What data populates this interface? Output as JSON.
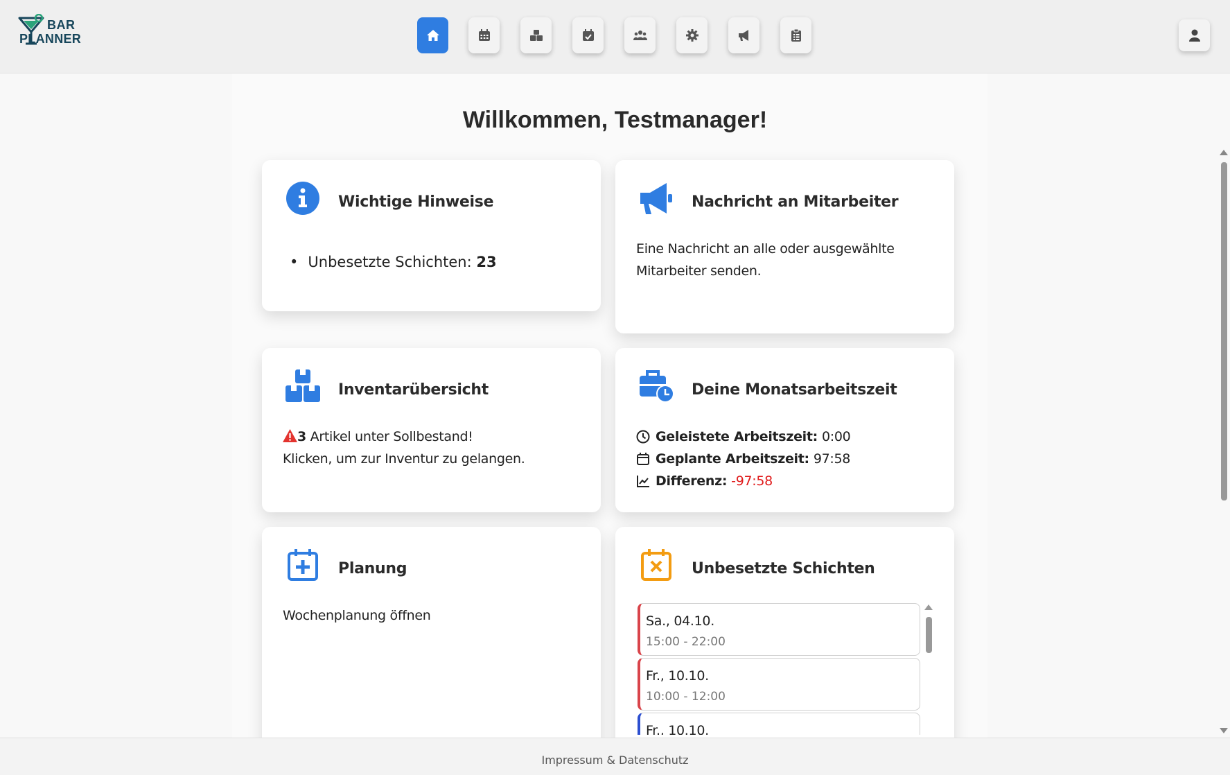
{
  "app": {
    "logo_line1": "BAR",
    "logo_line2": "PLANNER"
  },
  "nav": {
    "items": [
      {
        "icon": "home-icon",
        "active": true
      },
      {
        "icon": "calendar-grid-icon",
        "active": false
      },
      {
        "icon": "boxes-icon",
        "active": false
      },
      {
        "icon": "calendar-check-icon",
        "active": false
      },
      {
        "icon": "users-icon",
        "active": false
      },
      {
        "icon": "gear-icon",
        "active": false
      },
      {
        "icon": "megaphone-icon",
        "active": false
      },
      {
        "icon": "clipboard-list-icon",
        "active": false
      }
    ],
    "user_icon": "user-icon",
    "accent": "#2f7de1"
  },
  "page": {
    "title": "Willkommen, Testmanager!"
  },
  "cards": {
    "hints": {
      "title": "Wichtige Hinweise",
      "item_label": "Unbesetzte Schichten:",
      "item_value": "23"
    },
    "message": {
      "title": "Nachricht an Mitarbeiter",
      "text_line1": "Eine Nachricht an alle oder ausgewählte",
      "text_line2": "Mitarbeiter senden."
    },
    "inventory": {
      "title": "Inventarübersicht",
      "count": "3",
      "warning": "Artikel unter Sollbestand!",
      "hint": "Klicken, um zur Inventur zu gelangen."
    },
    "worktime": {
      "title": "Deine Monatsarbeitszeit",
      "done_label": "Geleistete Arbeitszeit:",
      "done_value": "0:00",
      "planned_label": "Geplante Arbeitszeit:",
      "planned_value": "97:58",
      "diff_label": "Differenz:",
      "diff_value": "-97:58"
    },
    "planning": {
      "title": "Planung",
      "text": "Wochenplanung öffnen"
    },
    "open_shifts": {
      "title": "Unbesetzte Schichten",
      "shifts": [
        {
          "date": "Sa., 04.10.",
          "time": "15:00 - 22:00"
        },
        {
          "date": "Fr., 10.10.",
          "time": "10:00 - 12:00"
        },
        {
          "date": "Fr., 10.10.",
          "time": ""
        }
      ]
    }
  },
  "footer": {
    "link": "Impressum & Datenschutz"
  }
}
